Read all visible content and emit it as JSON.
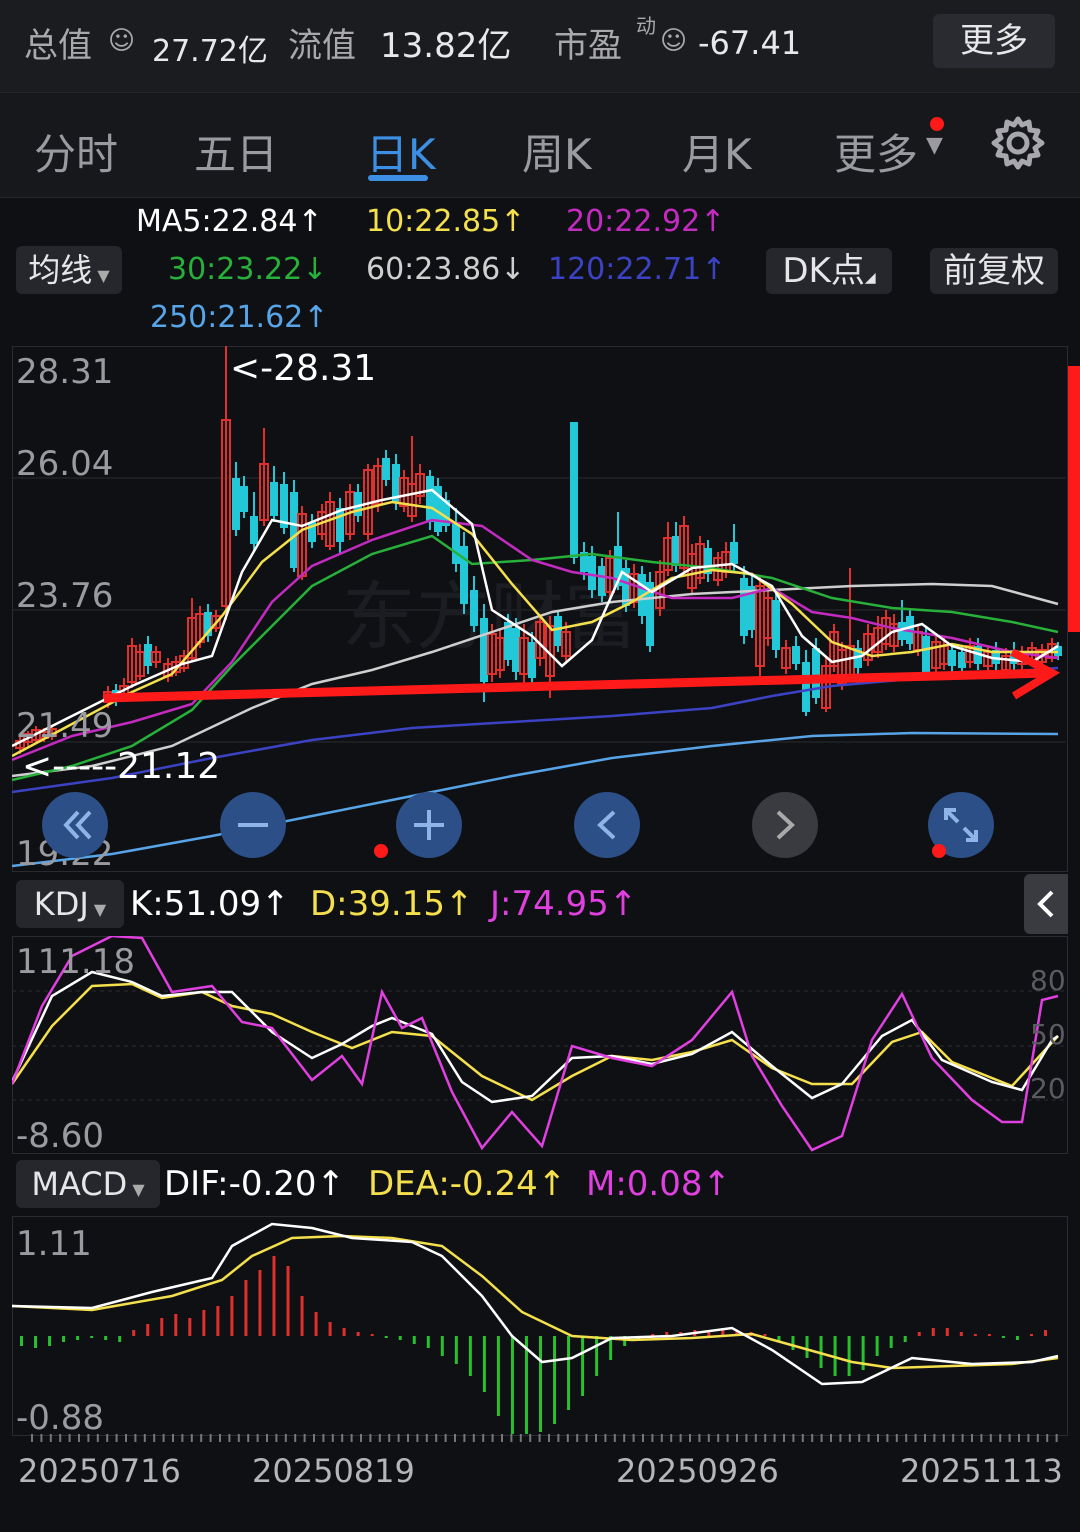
{
  "header": {
    "total_value_label": "总值",
    "total_value": "27.72亿",
    "float_value_label": "流值",
    "float_value": "13.82亿",
    "pe_label": "市盈",
    "pe_sup": "动",
    "pe_value": "-67.41",
    "more_label": "更多"
  },
  "tabs": [
    {
      "label": "分时"
    },
    {
      "label": "五日"
    },
    {
      "label": "日K",
      "active": true
    },
    {
      "label": "周K"
    },
    {
      "label": "月K"
    },
    {
      "label": "更多"
    }
  ],
  "ma_bar": {
    "selector_label": "均线",
    "ma5": "MA5:22.84↑",
    "ma10": "10:22.85↑",
    "ma20": "20:22.92↑",
    "ma30": "30:23.22↓",
    "ma60": "60:23.86↓",
    "ma120": "120:22.71↑",
    "ma250": "250:21.62↑",
    "dk_button": "DK点",
    "adjust_button": "前复权"
  },
  "colors": {
    "up": "#e0302c",
    "down": "#23c8d8",
    "ma5": "#ffffff",
    "ma10": "#f4e04d",
    "ma20": "#c32bc0",
    "ma30": "#27b03a",
    "ma60": "#cfcfcf",
    "ma120": "#3b43c4",
    "ma250": "#58a4e8",
    "accent": "#3d8fe3",
    "arrow": "#ff1a1a"
  },
  "price_chart": {
    "axis_labels": [
      "28.31",
      "26.04",
      "23.76",
      "21.49",
      "19.22"
    ],
    "high_marker": "<-28.31",
    "low_marker": "<-----21.12",
    "watermark": "东方财富"
  },
  "controls": [
    {
      "name": "fast-back-icon"
    },
    {
      "name": "zoom-out-icon"
    },
    {
      "name": "zoom-in-icon"
    },
    {
      "name": "prev-icon"
    },
    {
      "name": "next-icon"
    },
    {
      "name": "fullscreen-icon"
    }
  ],
  "kdj": {
    "selector_label": "KDJ",
    "k": "K:51.09↑",
    "d": "D:39.15↑",
    "j": "J:74.95↑",
    "axis_top": "111.18",
    "axis_bottom": "-8.60",
    "level_80": "80",
    "level_50": "50",
    "level_20": "20"
  },
  "macd": {
    "selector_label": "MACD",
    "dif": "DIF:-0.20↑",
    "dea": "DEA:-0.24↑",
    "m": "M:0.08↑",
    "axis_top": "1.11",
    "axis_bottom": "-0.88"
  },
  "dates": [
    "20250716",
    "20250819",
    "20250926",
    "20251113"
  ]
}
